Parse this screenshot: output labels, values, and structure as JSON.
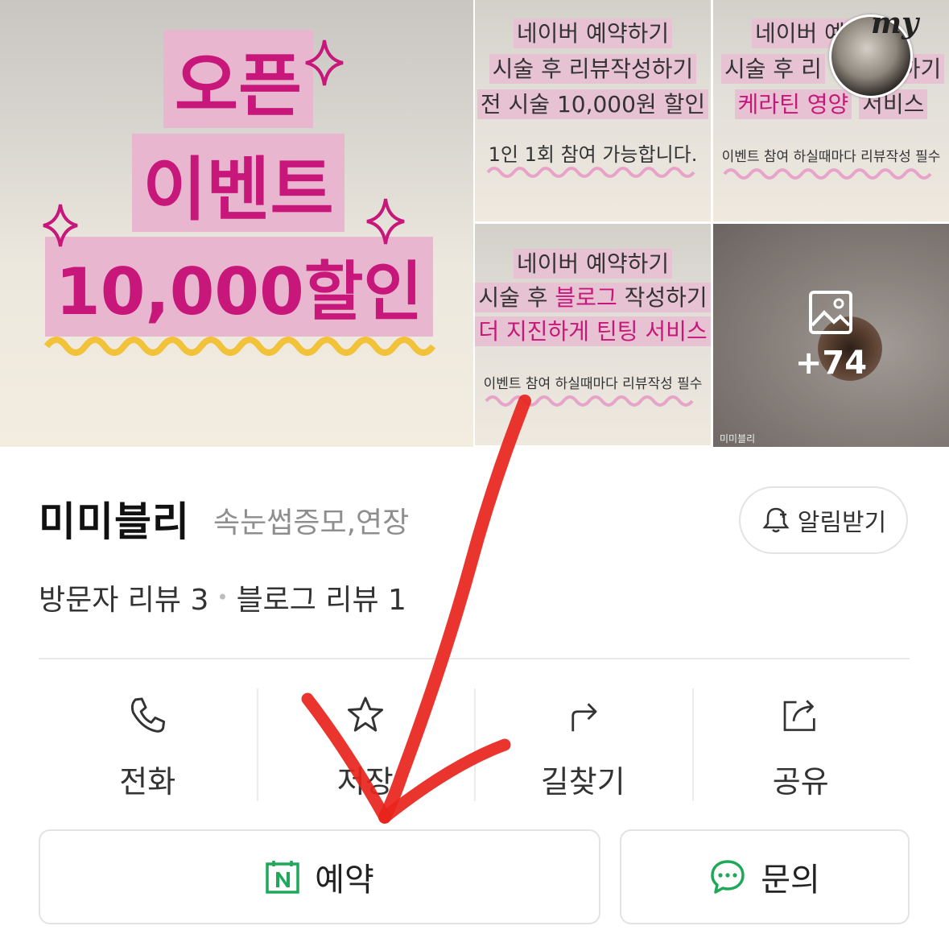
{
  "gallery": {
    "main_promo": {
      "line1": "오픈",
      "line2": "이벤트",
      "line3": "10,000할인"
    },
    "tile1": {
      "lines": [
        "네이버 예약하기",
        "시술 후 리뷰작성하기",
        "전 시술 10,000원 할인"
      ],
      "note": "1인 1회 참여 가능합니다."
    },
    "tile2": {
      "lines": [
        "네이버 예",
        "시술 후 리",
        "하기",
        "케라틴 영양",
        "서비스"
      ],
      "note": "이벤트 참여 하실때마다 리뷰작성 필수"
    },
    "tile3": {
      "line1": "네이버 예약하기",
      "line2_a": "시술 후 ",
      "line2_b": "블로그",
      "line2_c": " 작성하기",
      "line3": "더 지진하게 틴팅 서비스",
      "note": "이벤트 참여 하실때마다 리뷰작성 필수"
    },
    "more_count": "+74",
    "watermark": "미미블리",
    "avatar_label": "my"
  },
  "place": {
    "name": "미미블리",
    "category": "속눈썹증모,연장",
    "notify_label": "알림받기",
    "visitor_reviews": "방문자 리뷰 3",
    "blog_reviews": "블로그 리뷰 1"
  },
  "actions": [
    {
      "label": "전화",
      "icon": "phone-icon"
    },
    {
      "label": "저장",
      "icon": "star-icon"
    },
    {
      "label": "길찾기",
      "icon": "directions-icon"
    },
    {
      "label": "공유",
      "icon": "share-icon"
    }
  ],
  "buttons": {
    "reserve": "예약",
    "inquiry": "문의"
  },
  "colors": {
    "promo_pink": "#c8177a",
    "highlight": "#e9b6cf",
    "naver_green": "#1fa85a",
    "arrow_red": "#e8241d"
  }
}
